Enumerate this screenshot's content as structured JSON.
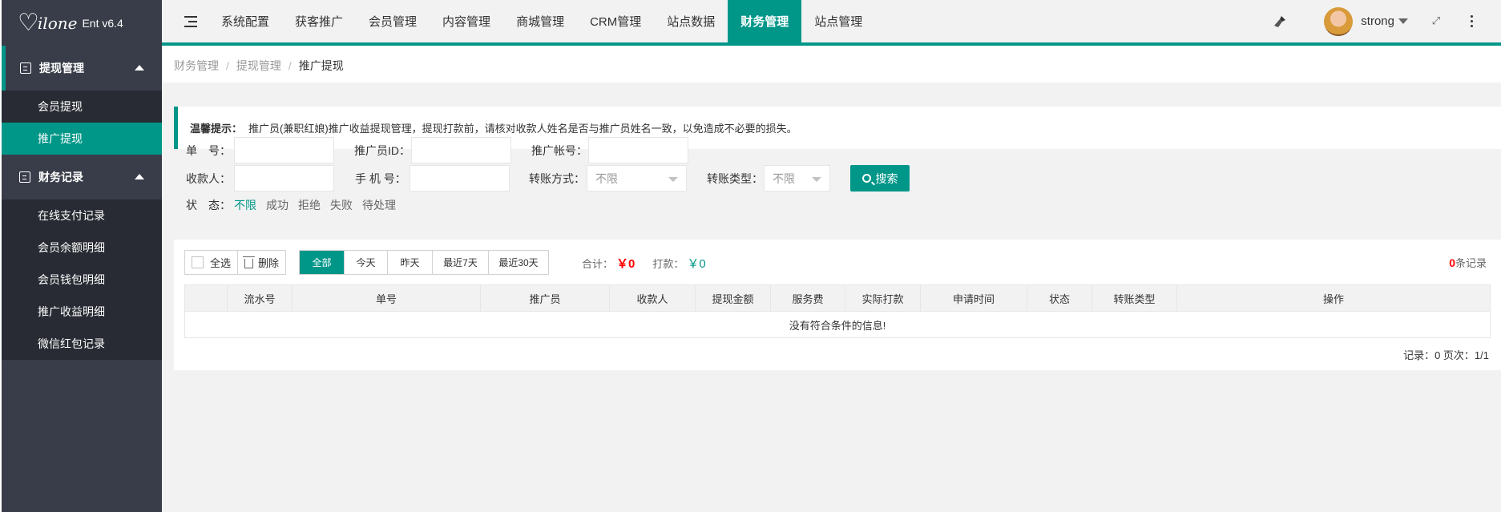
{
  "brand": {
    "logo_heart": "♡",
    "logo_script": "ilone",
    "version": "Ent v6.4"
  },
  "sidebar": {
    "groups": [
      {
        "label": "提现管理",
        "items": [
          "会员提现",
          "推广提现"
        ],
        "selected": "推广提现"
      },
      {
        "label": "财务记录",
        "items": [
          "在线支付记录",
          "会员余额明细",
          "会员钱包明细",
          "推广收益明细",
          "微信红包记录"
        ]
      }
    ]
  },
  "topnav": {
    "items": [
      "系统配置",
      "获客推广",
      "会员管理",
      "内容管理",
      "商城管理",
      "CRM管理",
      "站点数据",
      "财务管理",
      "站点管理"
    ],
    "active": "财务管理"
  },
  "user": {
    "name": "strong"
  },
  "breadcrumb": [
    "财务管理",
    "提现管理",
    "推广提现"
  ],
  "breadcrumb_sep": "/",
  "tip": {
    "title": "温馨提示：",
    "text": "推广员(兼职红娘)推广收益提现管理，提现打款前，请核对收款人姓名是否与推广员姓名一致，以免造成不必要的损失。"
  },
  "filters": {
    "order_no_label": "单　号：",
    "promoter_id_label": "推广员ID：",
    "promoter_account_label": "推广帐号：",
    "payee_label": "收款人：",
    "phone_label": "手 机 号：",
    "transfer_method_label": "转账方式：",
    "transfer_method_value": "不限",
    "transfer_type_label": "转账类型：",
    "transfer_type_value": "不限",
    "search_label": "搜索",
    "status_label": "状　态：",
    "status_options": [
      "不限",
      "成功",
      "拒绝",
      "失败",
      "待处理"
    ],
    "status_selected": "不限"
  },
  "toolbar": {
    "select_all": "全选",
    "delete": "删除"
  },
  "periods": {
    "options": [
      "全部",
      "今天",
      "昨天",
      "最近7天",
      "最近30天"
    ],
    "selected": "全部"
  },
  "totals": {
    "total_label": "合计：",
    "total_value": "￥0",
    "paid_label": "打款：",
    "paid_value": "￥0"
  },
  "record_count": {
    "num": "0",
    "suffix": "条记录"
  },
  "table": {
    "columns": [
      "",
      "流水号",
      "单号",
      "推广员",
      "收款人",
      "提现金额",
      "服务费",
      "实际打款",
      "申请时间",
      "状态",
      "转账类型",
      "操作"
    ],
    "empty_message": "没有符合条件的信息!"
  },
  "pager": {
    "text": "记录：0  页次：1/1"
  },
  "colors": {
    "accent": "#009688",
    "sidebar": "#393d49",
    "sidebar_sub": "#282b33",
    "red": "#ff0000"
  }
}
